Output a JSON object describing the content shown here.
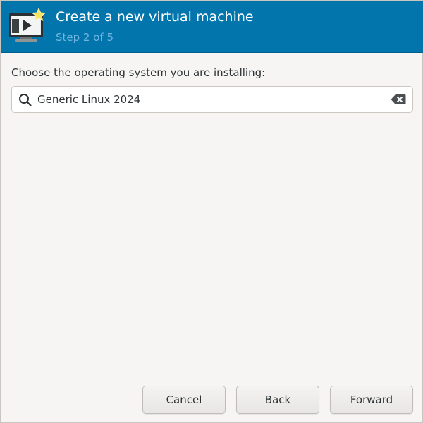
{
  "header": {
    "title": "Create a new virtual machine",
    "subtitle": "Step 2 of 5",
    "icon": "new-vm-icon",
    "background_color": "#0175ac"
  },
  "os_selection": {
    "prompt": "Choose the operating system you are installing:",
    "search_value": "Generic Linux 2024"
  },
  "buttons": {
    "cancel": "Cancel",
    "back": "Back",
    "forward": "Forward"
  }
}
